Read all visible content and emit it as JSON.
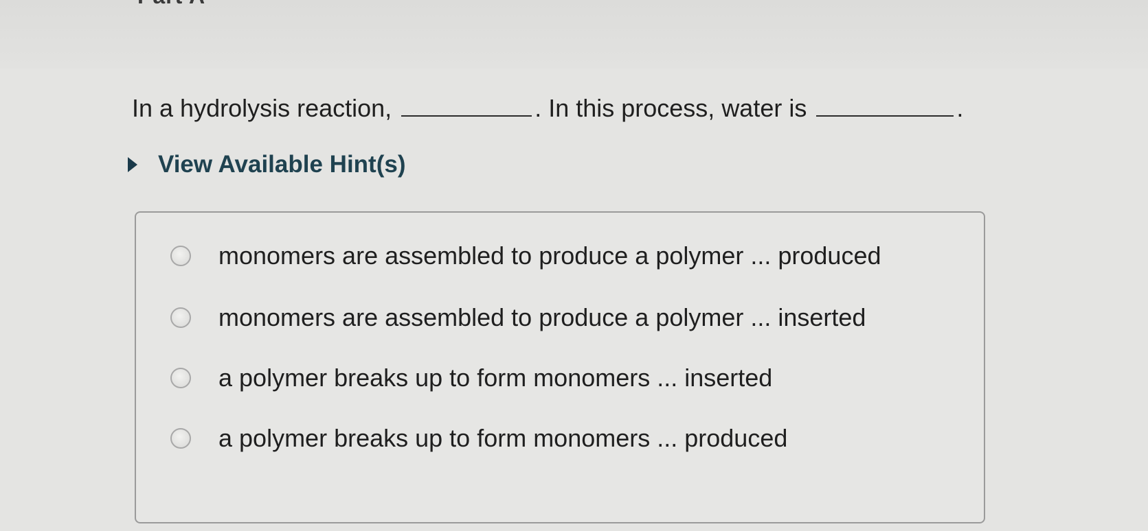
{
  "header": {
    "part_title": "Part A"
  },
  "question": {
    "prefix": "In a hydrolysis reaction,",
    "middle": ". In this process, water is",
    "suffix": "."
  },
  "hints": {
    "label": "View Available Hint(s)"
  },
  "options": [
    {
      "label": "monomers are assembled to produce a polymer ... produced"
    },
    {
      "label": "monomers are assembled to produce a polymer ... inserted"
    },
    {
      "label": "a polymer breaks up to form monomers ... inserted"
    },
    {
      "label": "a polymer breaks up to form monomers ... produced"
    }
  ]
}
